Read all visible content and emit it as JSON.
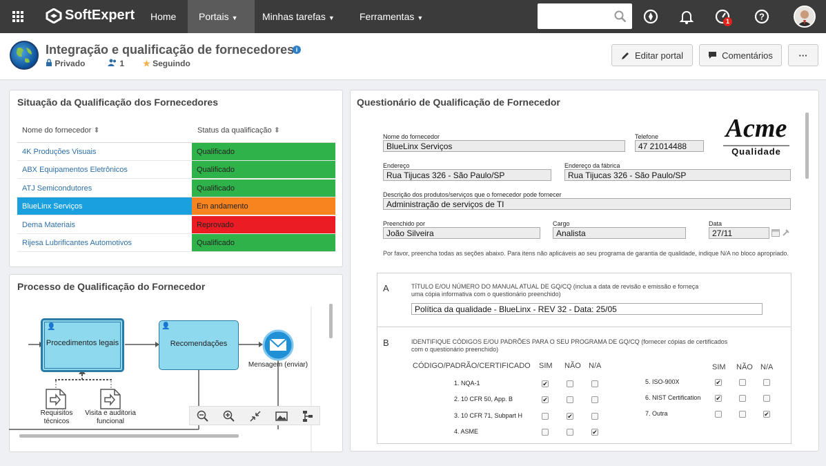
{
  "topbar": {
    "logo": "SoftExpert",
    "nav": [
      {
        "label": "Home"
      },
      {
        "label": "Portais"
      },
      {
        "label": "Minhas tarefas"
      },
      {
        "label": "Ferramentas"
      }
    ],
    "search_placeholder": "",
    "notification_badge": "1",
    "colors": {
      "bar": "#3b3b3b",
      "active": "#5b5b5b",
      "badge": "#e2231a"
    }
  },
  "header": {
    "title": "Integração e qualificação de fornecedores",
    "privacy": "Privado",
    "members": "1",
    "following": "Seguindo",
    "edit_button": "Editar portal",
    "comments_button": "Comentários",
    "more_button": "···"
  },
  "supplier_status": {
    "title": "Situação da Qualificação dos Fornecedores",
    "col_name": "Nome do fornecedor",
    "col_status": "Status da qualificação",
    "rows": [
      {
        "name": "4K Produções Visuais",
        "status": "Qualificado",
        "color": "#2fb24a"
      },
      {
        "name": "ABX Equipamentos Eletrônicos",
        "status": "Qualificado",
        "color": "#2fb24a"
      },
      {
        "name": "ATJ Semicondutores",
        "status": "Qualificado",
        "color": "#2fb24a"
      },
      {
        "name": "BlueLinx Serviços",
        "status": "Em andamento",
        "color": "#f7841f"
      },
      {
        "name": "Dema Materiais",
        "status": "Reprovado",
        "color": "#ec1c24"
      },
      {
        "name": "Rijesa Lubrificantes Automotivos",
        "status": "Qualificado",
        "color": "#2fb24a"
      }
    ]
  },
  "process": {
    "title": "Processo de Qualificação do Fornecedor",
    "task1": "Procedimentos legais",
    "task2": "Recomendações",
    "event": "Mensagem (enviar)",
    "doc1": "Requisitos técnicos",
    "doc2": "Visita e auditoria funcional"
  },
  "questionnaire": {
    "title": "Questionário de Qualificação de Fornecedor",
    "logo_text": "Acme",
    "logo_sub": "Qualidade",
    "fields": {
      "supplier_label": "Nome do fornecedor",
      "supplier_value": "BlueLinx Serviços",
      "phone_label": "Telefone",
      "phone_value": "47 21014488",
      "address_label": "Endereço",
      "address_value": "Rua Tijucas 326 - São Paulo/SP",
      "factory_label": "Endereço da fábrica",
      "factory_value": "Rua Tijucas 326 - São Paulo/SP",
      "desc_label": "Descrição dos produtos/serviços que o fornecedor pode fornecer",
      "desc_value": "Administração de serviços de TI",
      "filled_label": "Preenchido por",
      "filled_value": "João Silveira",
      "role_label": "Cargo",
      "role_value": "Analista",
      "date_label": "Data",
      "date_value": "27/11"
    },
    "instructions": "Por favor, preencha todas as seções abaixo. Para itens não aplicáveis ao seu programa de garantia de qualidade, indique N/A no bloco apropriado.",
    "section_a": {
      "letter": "A",
      "text": "TÍTULO E/OU NÚMERO DO MANUAL ATUAL DE GQ/CQ (inclua a data de revisão e emissão e forneça uma cópia informativa com o questionário preenchido)",
      "value": "Política da qualidade - BlueLinx - REV 32 - Data: 25/05"
    },
    "section_b": {
      "letter": "B",
      "text": "IDENTIFIQUE CÓDIGOS E/OU PADRÕES PARA O SEU PROGRAMA DE GQ/CQ (fornecer cópias de certificados com o questionário preenchido)",
      "col_code": "CÓDIGO/PADRÃO/CERTIFICADO",
      "col_yes": "SIM",
      "col_no": "NÃO",
      "col_na": "N/A",
      "left_items": [
        {
          "label": "1. NQA-1",
          "sim": true,
          "nao": false,
          "na": false
        },
        {
          "label": "2. 10 CFR 50, App. B",
          "sim": true,
          "nao": false,
          "na": false
        },
        {
          "label": "3. 10 CFR 71, Subpart H",
          "sim": false,
          "nao": true,
          "na": false
        },
        {
          "label": "4. ASME",
          "sim": false,
          "nao": false,
          "na": true
        }
      ],
      "right_items": [
        {
          "label": "5. ISO-900X",
          "sim": true,
          "nao": false,
          "na": false
        },
        {
          "label": "6. NIST Certification",
          "sim": true,
          "nao": false,
          "na": false
        },
        {
          "label": "7. Outra",
          "sim": false,
          "nao": false,
          "na": true
        }
      ]
    }
  }
}
